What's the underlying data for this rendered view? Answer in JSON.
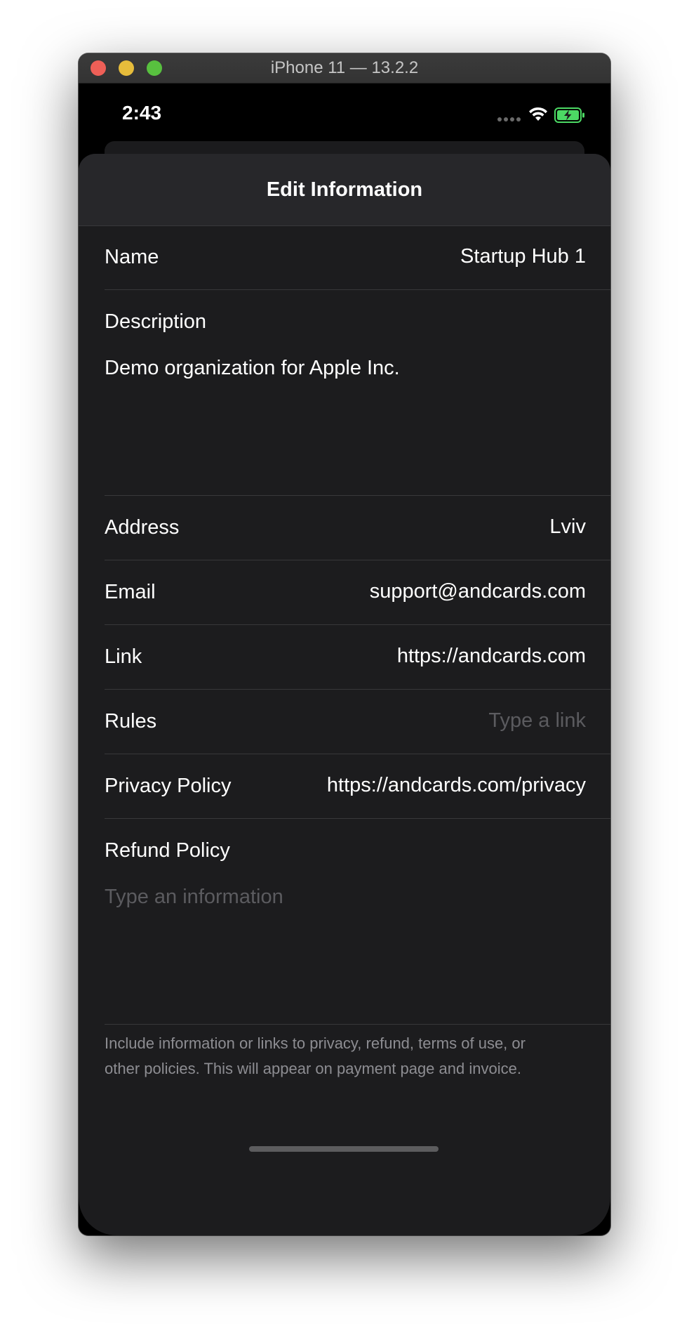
{
  "window": {
    "title": "iPhone 11 — 13.2.2"
  },
  "status_bar": {
    "time": "2:43"
  },
  "nav": {
    "title": "Edit Information"
  },
  "form": {
    "name": {
      "label": "Name",
      "value": "Startup Hub 1"
    },
    "description": {
      "label": "Description",
      "value": "Demo organization for Apple Inc."
    },
    "address": {
      "label": "Address",
      "value": "Lviv"
    },
    "email": {
      "label": "Email",
      "value": "support@andcards.com"
    },
    "link": {
      "label": "Link",
      "value": "https://andcards.com"
    },
    "rules": {
      "label": "Rules",
      "placeholder": "Type a link"
    },
    "privacy_policy": {
      "label": "Privacy Policy",
      "value": "https://andcards.com/privacy"
    },
    "refund_policy": {
      "label": "Refund Policy",
      "placeholder": "Type an information"
    }
  },
  "footer_note": {
    "line1": "Include information or links to privacy, refund, terms of use, or",
    "line2": "other policies. This will appear on payment page and invoice."
  },
  "colors": {
    "background": "#1c1c1e",
    "nav_background": "#27272a",
    "separator": "#38383a",
    "placeholder": "#5b5b5f",
    "footer_text": "#8d8d92",
    "battery_fill": "#4cd964"
  }
}
